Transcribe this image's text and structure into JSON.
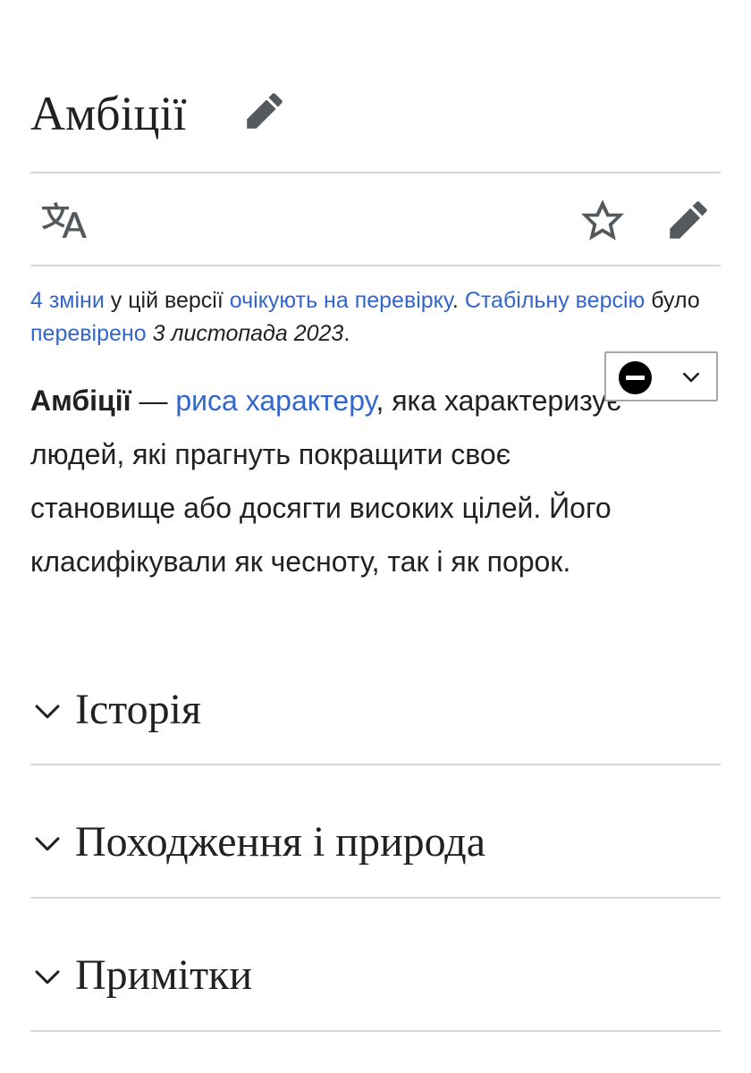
{
  "article": {
    "title": "Амбіції"
  },
  "icons": {
    "title_edit": "pencil-icon",
    "language": "translate-icon",
    "watch": "star-icon",
    "edit": "pencil-icon",
    "badge_status": "minus-circle-icon",
    "badge_toggle": "chevron-down-icon",
    "section_toggle": "chevron-down-icon"
  },
  "notice": {
    "changes_link": "4 зміни",
    "text1": " у цій версії ",
    "pending_link": "очікують на перевірку",
    "text2": ". ",
    "stable_link": "Стабільну версію",
    "text3": " було ",
    "checked_link": "перевірено",
    "text4": " ",
    "date": "3 листопада 2023",
    "text5": "."
  },
  "lead": {
    "term": "Амбіції",
    "dash": " — ",
    "link": "риса характеру",
    "rest": ", яка характеризує людей, які прагнуть покращити своє становище або досягти високих цілей. Його класифікували як чесноту, так і як порок."
  },
  "sections": [
    {
      "title": "Історія"
    },
    {
      "title": "Походження і природа"
    },
    {
      "title": "Примітки"
    }
  ],
  "colors": {
    "link": "#3366cc",
    "text": "#202122",
    "icon": "#54595d",
    "divider": "#d6d7d9"
  }
}
